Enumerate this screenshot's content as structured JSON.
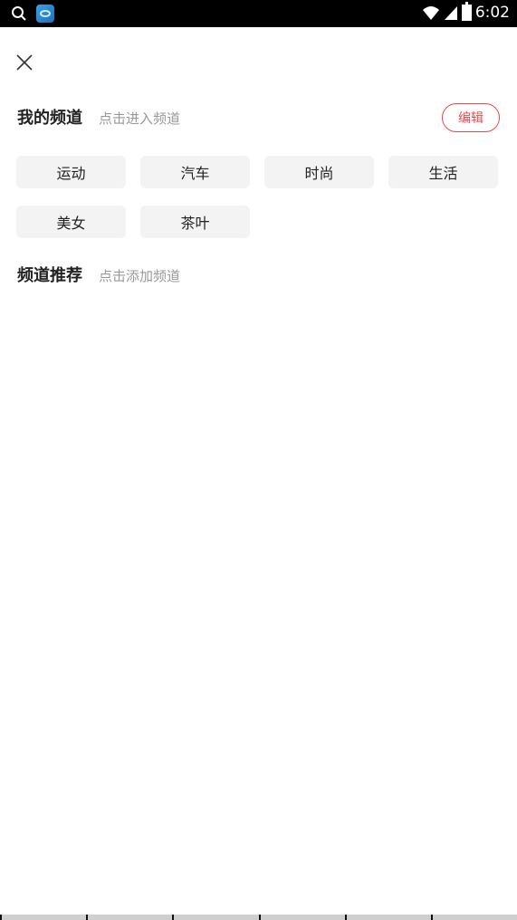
{
  "status_bar": {
    "time": "6:02"
  },
  "icons": {
    "search": "search-icon",
    "app": "app-icon",
    "wifi": "wifi-icon",
    "signal": "signal-icon",
    "battery": "battery-icon",
    "close": "close-icon"
  },
  "my_channels": {
    "title": "我的频道",
    "hint": "点击进入频道",
    "edit_label": "编辑",
    "items": [
      {
        "label": "运动"
      },
      {
        "label": "汽车"
      },
      {
        "label": "时尚"
      },
      {
        "label": "生活"
      },
      {
        "label": "美女"
      },
      {
        "label": "茶叶"
      }
    ]
  },
  "recommended": {
    "title": "频道推荐",
    "hint": "点击添加频道"
  },
  "colors": {
    "accent": "#e8494b",
    "chip_bg": "#f3f3f3",
    "hint_text": "#999999",
    "title_text": "#222222"
  }
}
